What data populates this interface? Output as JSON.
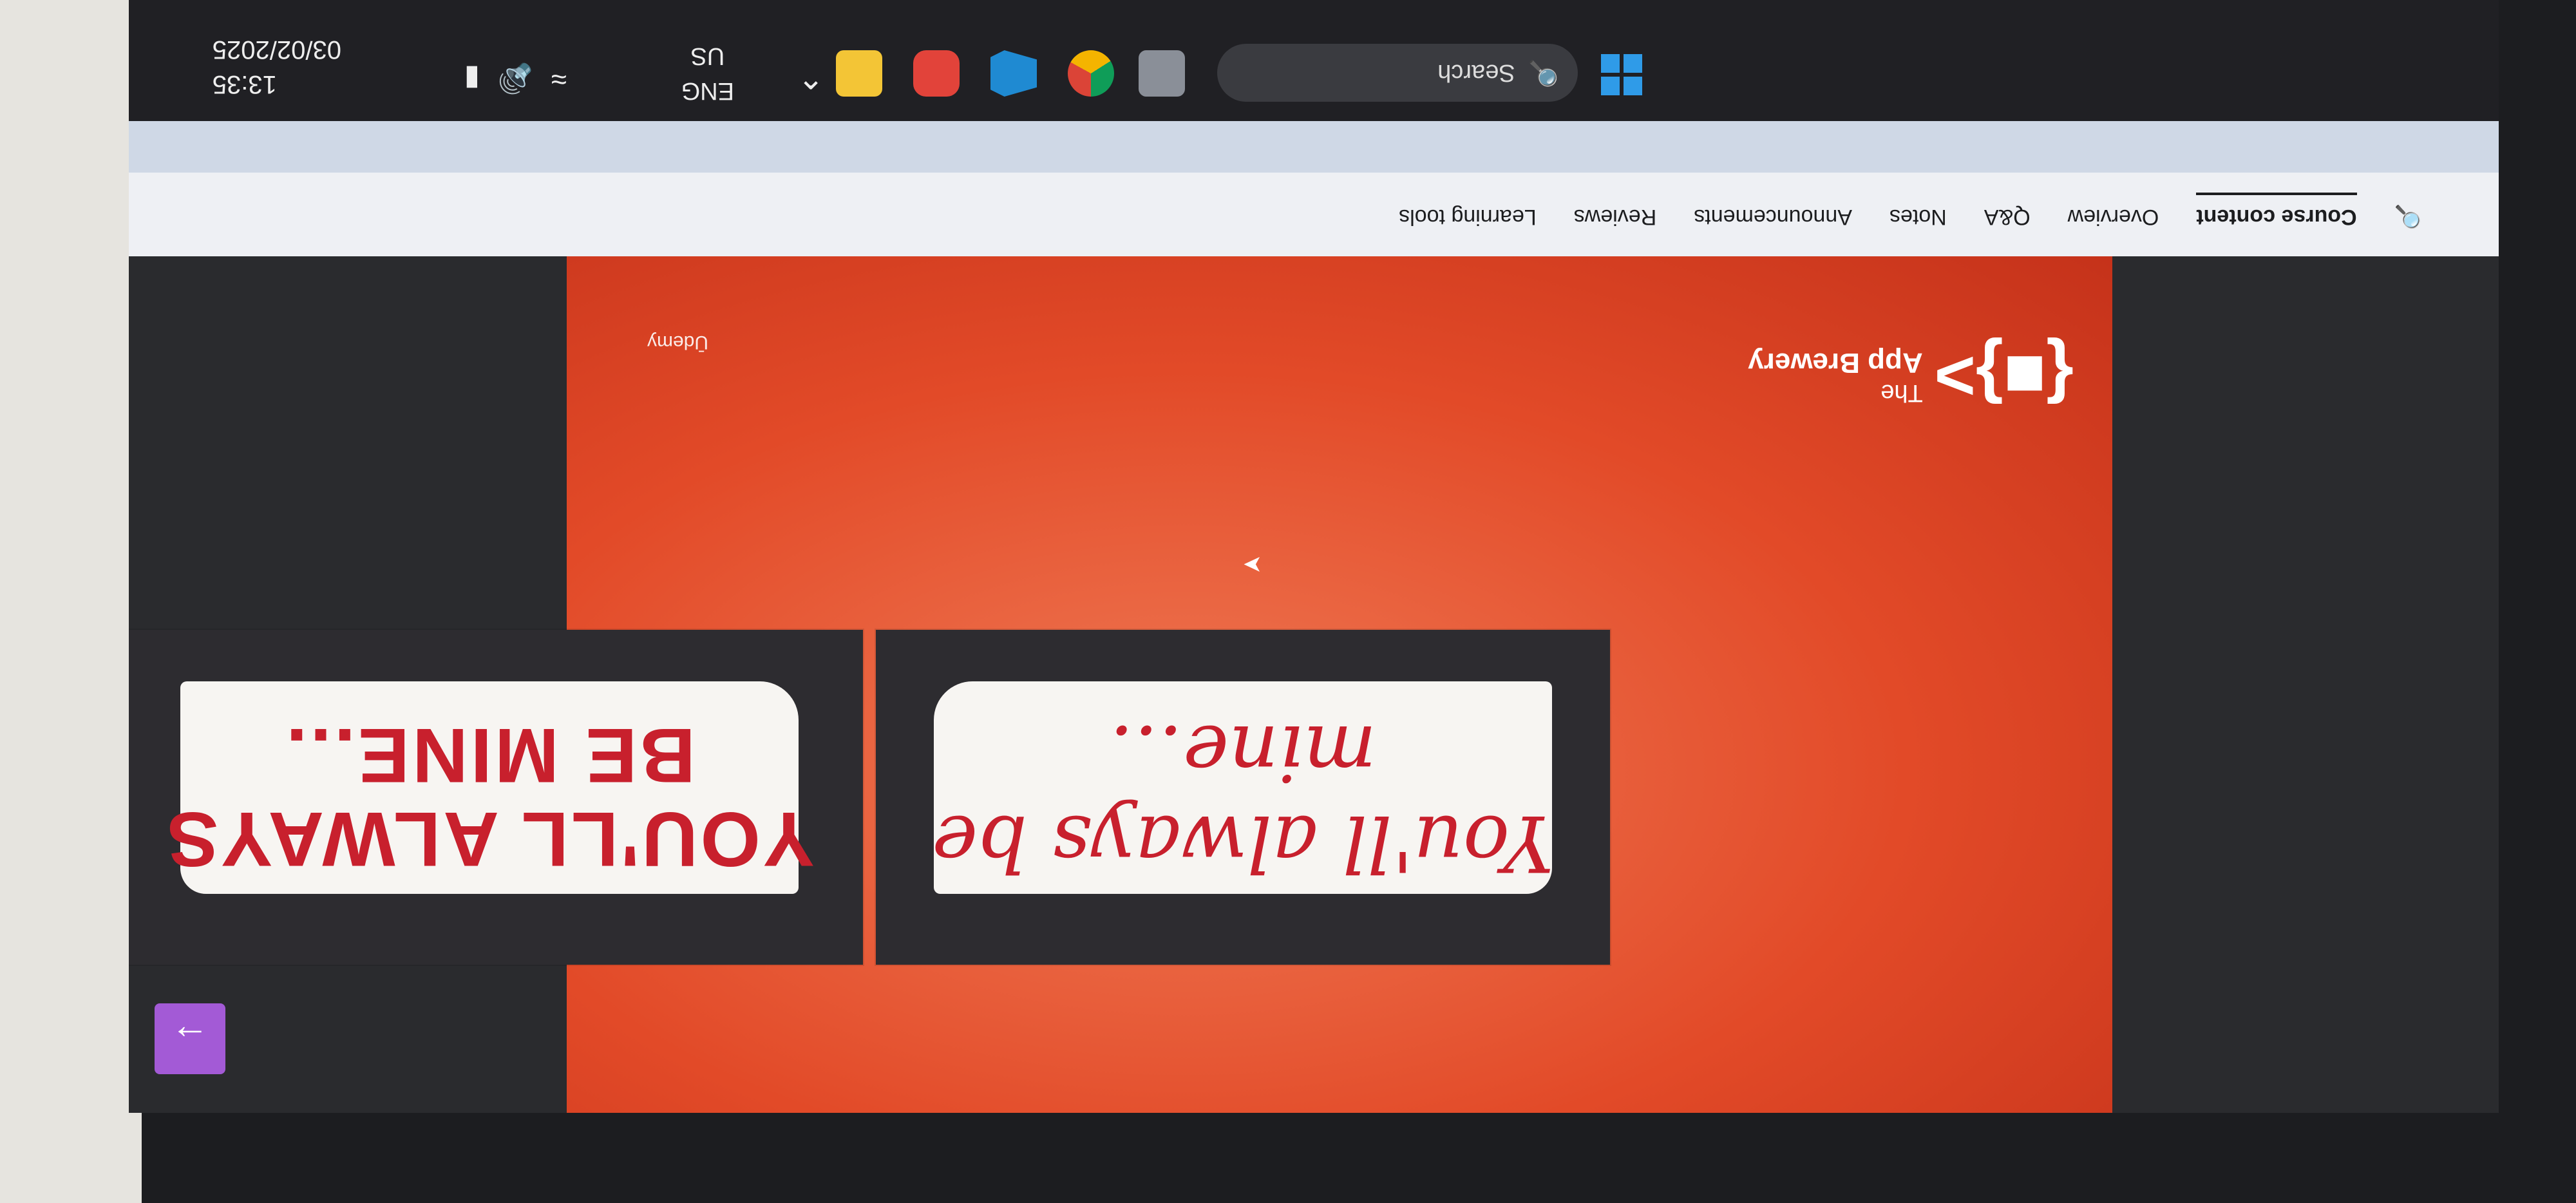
{
  "taskbar": {
    "search_placeholder": "Search",
    "language": "ENG",
    "region": "US",
    "time": "13:35",
    "date": "03/02/2025"
  },
  "course_nav": {
    "tabs": [
      {
        "label": "Course content"
      },
      {
        "label": "Overview"
      },
      {
        "label": "Q&A"
      },
      {
        "label": "Notes"
      },
      {
        "label": "Announcements"
      },
      {
        "label": "Reviews"
      },
      {
        "label": "Learning tools"
      }
    ]
  },
  "video": {
    "logo_line1": "The",
    "logo_line2": "App Brewery",
    "watermark": "Ūdemy",
    "script_note": "You'll always be mine...",
    "block_note": "YOU'LL ALWAYS BE MINE..."
  },
  "colors": {
    "slide_accent": "#e24a28",
    "note_text": "#c8202d",
    "next_button": "#a35ad6"
  }
}
